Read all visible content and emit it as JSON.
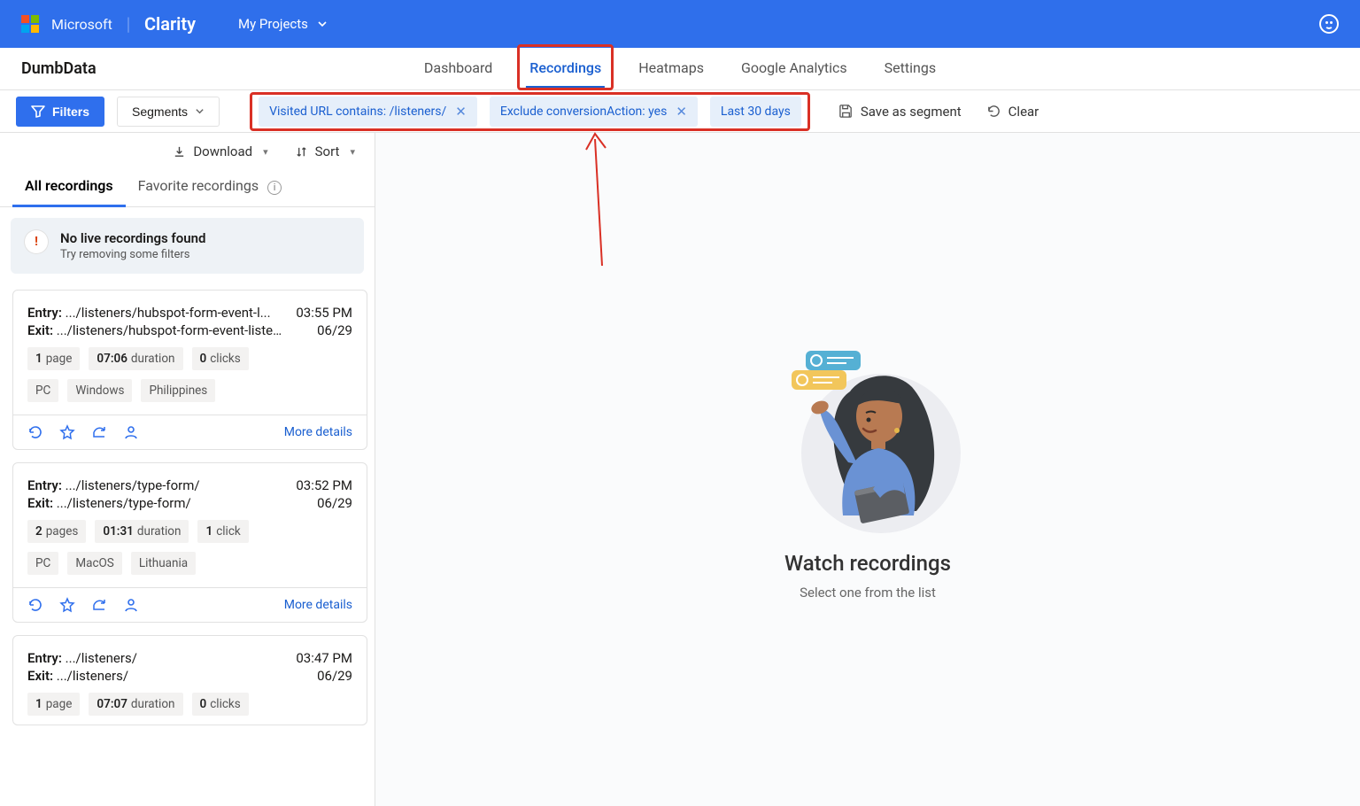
{
  "header": {
    "company": "Microsoft",
    "product": "Clarity",
    "projects_label": "My Projects"
  },
  "project": {
    "name": "DumbData",
    "tabs": [
      "Dashboard",
      "Recordings",
      "Heatmaps",
      "Google Analytics",
      "Settings"
    ],
    "active_tab": "Recordings"
  },
  "filter_bar": {
    "filters_btn": "Filters",
    "segments_btn": "Segments",
    "chips": [
      {
        "label": "Visited URL contains: /listeners/",
        "closable": true
      },
      {
        "label": "Exclude conversionAction: yes",
        "closable": true
      },
      {
        "label": "Last 30 days",
        "closable": false
      }
    ],
    "save_segment": "Save as segment",
    "clear": "Clear"
  },
  "sidebar": {
    "download": "Download",
    "sort": "Sort",
    "tabs": {
      "all": "All recordings",
      "favorite": "Favorite recordings"
    },
    "alert_title": "No live recordings found",
    "alert_sub": "Try removing some filters",
    "more_details": "More details",
    "entry_label": "Entry:",
    "exit_label": "Exit:",
    "cards": [
      {
        "entry": ".../listeners/hubspot-form-event-l...",
        "exit": ".../listeners/hubspot-form-event-listen...",
        "time": "03:55 PM",
        "date": "06/29",
        "pages_n": "1",
        "pages_w": "page",
        "dur_n": "07:06",
        "dur_w": "duration",
        "clicks_n": "0",
        "clicks_w": "clicks",
        "device": "PC",
        "os": "Windows",
        "country": "Philippines"
      },
      {
        "entry": ".../listeners/type-form/",
        "exit": ".../listeners/type-form/",
        "time": "03:52 PM",
        "date": "06/29",
        "pages_n": "2",
        "pages_w": "pages",
        "dur_n": "01:31",
        "dur_w": "duration",
        "clicks_n": "1",
        "clicks_w": "click",
        "device": "PC",
        "os": "MacOS",
        "country": "Lithuania"
      },
      {
        "entry": ".../listeners/",
        "exit": ".../listeners/",
        "time": "03:47 PM",
        "date": "06/29",
        "pages_n": "1",
        "pages_w": "page",
        "dur_n": "07:07",
        "dur_w": "duration",
        "clicks_n": "0",
        "clicks_w": "clicks",
        "device": "",
        "os": "",
        "country": ""
      }
    ]
  },
  "empty": {
    "title": "Watch recordings",
    "sub": "Select one from the list"
  }
}
